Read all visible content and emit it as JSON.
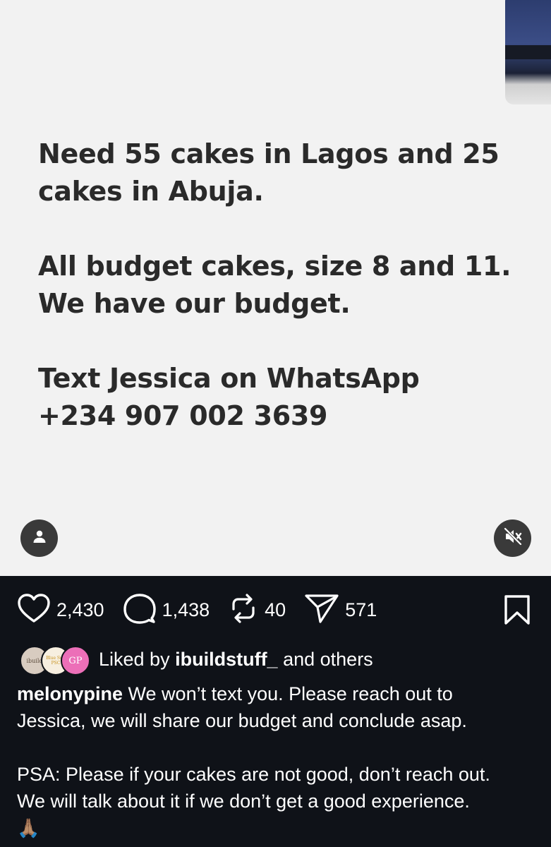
{
  "post": {
    "text_lines": {
      "line1": "Need 55 cakes in Lagos and 25",
      "line2": "cakes in Abuja.",
      "line3": "All budget cakes, size 8 and 11.",
      "line4": "We have our budget.",
      "line5": "Text Jessica on WhatsApp",
      "line6": "+234 907 002 3639"
    }
  },
  "actions": {
    "likes": "2,430",
    "comments": "1,438",
    "reposts": "40",
    "shares": "571"
  },
  "liked_by": {
    "prefix": "Liked by",
    "user": "ibuildstuff_",
    "suffix": "and others",
    "avatar1_text": "ibuild",
    "avatar2_text": "Blue Sun PSC",
    "avatar3_text": "GP"
  },
  "caption": {
    "username": "melonypine",
    "line1": "We won’t text you. Please reach out to",
    "line2": "Jessica, we will share our budget and conclude asap.",
    "line3": "PSA: Please if your cakes are not good, don’t reach out.",
    "line4": "We will talk about it if we don’t get a good experience.",
    "emoji": "🙏🏽"
  },
  "icons": {
    "like": "heart-icon",
    "comment": "comment-icon",
    "repost": "repost-icon",
    "share": "send-icon",
    "save": "bookmark-icon",
    "user": "user-icon",
    "mute": "speaker-muted-icon"
  },
  "colors": {
    "media_bg": "#f2f2f2",
    "dark_bg": "#0f1218",
    "text_dark": "#2a2a2a",
    "text_light": "#ffffff"
  }
}
